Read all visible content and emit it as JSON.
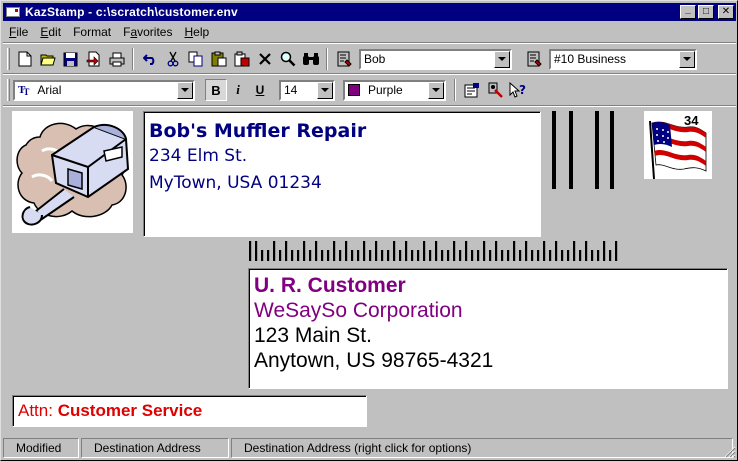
{
  "window": {
    "title": "KazStamp - c:\\scratch\\customer.env",
    "minimize_glyph": "_",
    "maximize_glyph": "□",
    "close_glyph": "✕"
  },
  "menu": [
    {
      "label": "File",
      "key": "F",
      "rest": "ile"
    },
    {
      "label": "Edit",
      "key": "E",
      "rest": "dit"
    },
    {
      "label": "Format",
      "key": "F",
      "rest": "ormat"
    },
    {
      "label": "Favorites",
      "key": "a",
      "pre": "F",
      "rest": "vorites"
    },
    {
      "label": "Help",
      "key": "H",
      "rest": "elp"
    }
  ],
  "toolbar1": {
    "icons": [
      "new-icon",
      "open-icon",
      "save-icon",
      "import-icon",
      "print-icon",
      "undo-icon",
      "cut-icon",
      "copy-icon",
      "paste-icon",
      "paste-special-icon",
      "delete-icon",
      "find-icon",
      "binoculars-icon",
      "address-book-icon"
    ],
    "return_address_select": "Bob",
    "envelope_size_select": "#10 Business"
  },
  "toolbar2": {
    "font_select": "Arial",
    "bold_label": "B",
    "italic_label": "i",
    "underline_label": "U",
    "font_size_select": "14",
    "color_select": "Purple",
    "colors": {
      "purple": "#800080"
    }
  },
  "return_address": {
    "line1": "Bob's Muffler Repair",
    "line2": "234 Elm St.",
    "line3": "MyTown, USA 01234",
    "color": "#000080"
  },
  "stamp": {
    "value": "34"
  },
  "destination": {
    "line1": "U. R. Customer",
    "line2": "WeSaySo Corporation",
    "line3": "123 Main St.",
    "line4": "Anytown, US 98765-4321"
  },
  "attn": {
    "prefix": "Attn: ",
    "value": "Customer Service",
    "color": "#e00000"
  },
  "statusbar": {
    "pane1": "Modified",
    "pane2": "Destination Address",
    "pane3": "Destination Address (right click for options)"
  }
}
